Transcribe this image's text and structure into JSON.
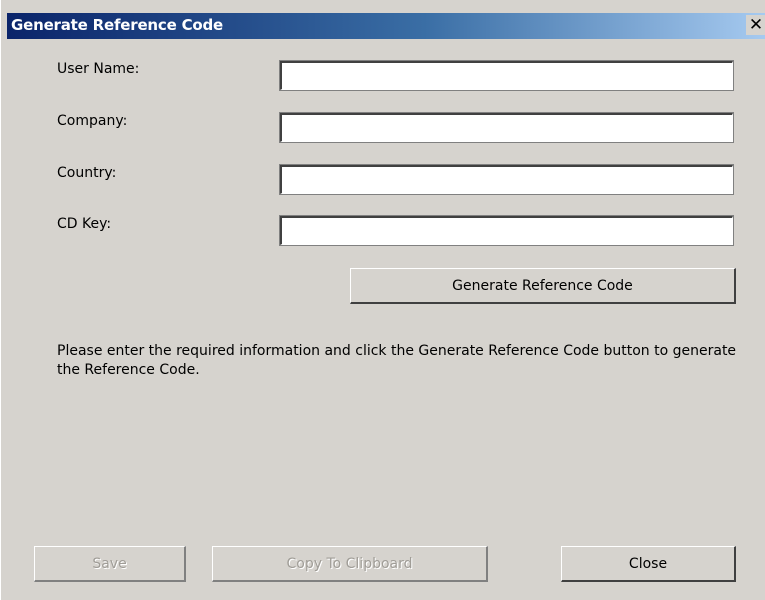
{
  "window": {
    "title": "Generate Reference Code",
    "close_glyph": "✕",
    "close_icon": "close-icon"
  },
  "form": {
    "fields": [
      {
        "label": "User Name:",
        "value": ""
      },
      {
        "label": "Company:",
        "value": ""
      },
      {
        "label": "Country:",
        "value": ""
      },
      {
        "label": "CD Key:",
        "value": ""
      }
    ],
    "generate_label": "Generate Reference Code"
  },
  "info": {
    "message": "Please enter the required information and click the Generate Reference Code button to generate the Reference Code."
  },
  "footer": {
    "save_label": "Save",
    "copy_label": "Copy To Clipboard",
    "close_label": "Close"
  },
  "colors": {
    "titlebar_start": "#0a246a",
    "titlebar_end": "#a6caf0",
    "dialog_bg": "#d6d3ce",
    "disabled_text": "#a09d97"
  }
}
